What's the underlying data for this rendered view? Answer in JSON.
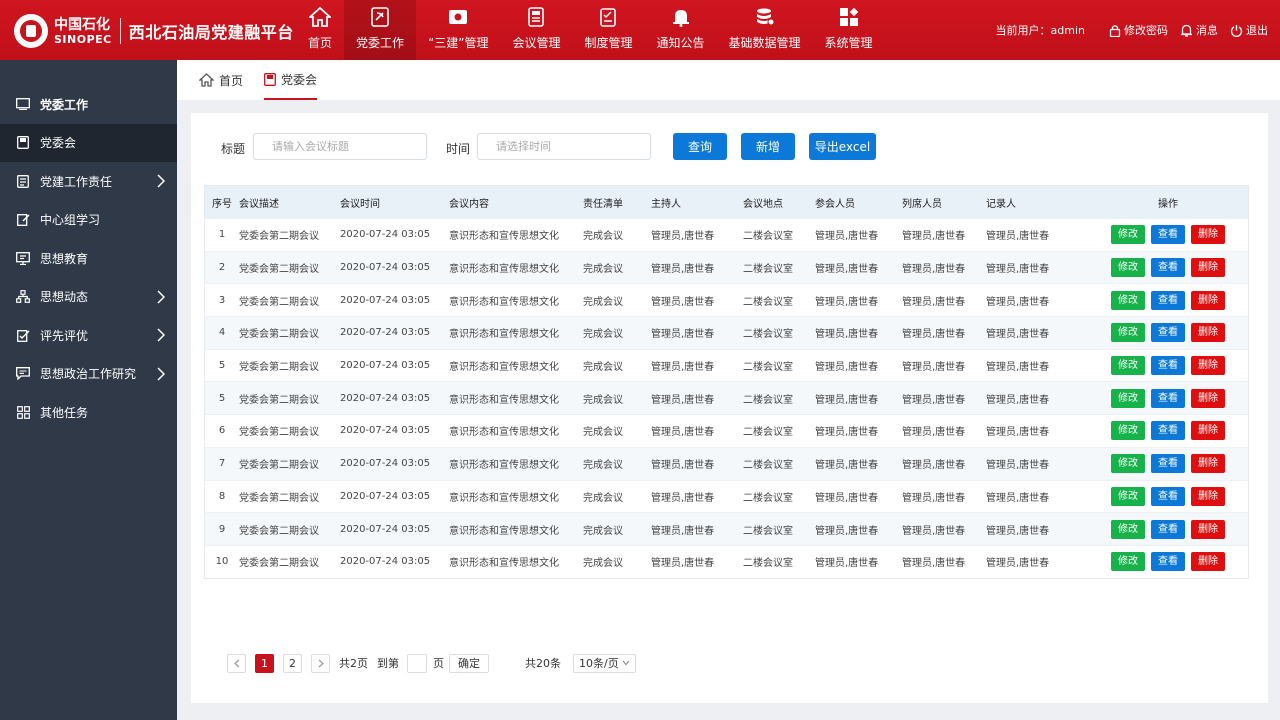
{
  "header": {
    "logo_cn": "中国石化",
    "logo_en": "SINOPEC",
    "title": "西北石油局党建融平台",
    "nav": [
      {
        "label": "首页",
        "icon": "home-icon"
      },
      {
        "label": "党委工作",
        "icon": "party-emblem-icon"
      },
      {
        "label": "“三建”管理",
        "icon": "building-icon"
      },
      {
        "label": "会议管理",
        "icon": "document-icon"
      },
      {
        "label": "制度管理",
        "icon": "checklist-icon"
      },
      {
        "label": "通知公告",
        "icon": "bell-icon"
      },
      {
        "label": "基础数据管理",
        "icon": "database-icon"
      },
      {
        "label": "系统管理",
        "icon": "grid-icon"
      }
    ],
    "current_user": "当前用户：admin",
    "change_password": "修改密码",
    "messages": "消息",
    "logout": "退出"
  },
  "sidebar": {
    "title": "党委工作",
    "items": [
      {
        "label": "党委会",
        "icon": "save-icon"
      },
      {
        "label": "党建工作责任",
        "icon": "document-icon"
      },
      {
        "label": "中心组学习",
        "icon": "edit-icon"
      },
      {
        "label": "思想教育",
        "icon": "screen-icon"
      },
      {
        "label": "思想动态",
        "icon": "org-chart-icon"
      },
      {
        "label": "评先评优",
        "icon": "edit-check-icon"
      },
      {
        "label": "思想政治工作研究",
        "icon": "chat-icon"
      },
      {
        "label": "其他任务",
        "icon": "grid-icon"
      }
    ]
  },
  "tabs": {
    "home": "首页",
    "current": "党委会"
  },
  "filters": {
    "title_label": "标题",
    "title_placeholder": "请输入会议标题",
    "time_label": "时间",
    "time_placeholder": "请选择时间",
    "search_btn": "查询",
    "add_btn": "新增",
    "export_btn": "导出excel"
  },
  "table": {
    "headers": [
      "序号",
      "会议描述",
      "会议时间",
      "会议内容",
      "责任清单",
      "主持人",
      "会议地点",
      "参会人员",
      "列席人员",
      "记录人",
      "操作"
    ],
    "rows": [
      [
        "1",
        "党委会第二期会议",
        "2020-07-24 03:05",
        "意识形态和宣传思想文化",
        "完成会议",
        "管理员,唐世春",
        "二楼会议室",
        "管理员,唐世春",
        "管理员,唐世春",
        "管理员,唐世春"
      ],
      [
        "2",
        "党委会第二期会议",
        "2020-07-24 03:05",
        "意识形态和宣传思想文化",
        "完成会议",
        "管理员,唐世春",
        "二楼会议室",
        "管理员,唐世春",
        "管理员,唐世春",
        "管理员,唐世春"
      ],
      [
        "3",
        "党委会第二期会议",
        "2020-07-24 03:05",
        "意识形态和宣传思想文化",
        "完成会议",
        "管理员,唐世春",
        "二楼会议室",
        "管理员,唐世春",
        "管理员,唐世春",
        "管理员,唐世春"
      ],
      [
        "4",
        "党委会第二期会议",
        "2020-07-24 03:05",
        "意识形态和宣传思想文化",
        "完成会议",
        "管理员,唐世春",
        "二楼会议室",
        "管理员,唐世春",
        "管理员,唐世春",
        "管理员,唐世春"
      ],
      [
        "5",
        "党委会第二期会议",
        "2020-07-24 03:05",
        "意识形态和宣传思想文化",
        "完成会议",
        "管理员,唐世春",
        "二楼会议室",
        "管理员,唐世春",
        "管理员,唐世春",
        "管理员,唐世春"
      ],
      [
        "5",
        "党委会第二期会议",
        "2020-07-24 03:05",
        "意识形态和宣传思想文化",
        "完成会议",
        "管理员,唐世春",
        "二楼会议室",
        "管理员,唐世春",
        "管理员,唐世春",
        "管理员,唐世春"
      ],
      [
        "6",
        "党委会第二期会议",
        "2020-07-24 03:05",
        "意识形态和宣传思想文化",
        "完成会议",
        "管理员,唐世春",
        "二楼会议室",
        "管理员,唐世春",
        "管理员,唐世春",
        "管理员,唐世春"
      ],
      [
        "7",
        "党委会第二期会议",
        "2020-07-24 03:05",
        "意识形态和宣传思想文化",
        "完成会议",
        "管理员,唐世春",
        "二楼会议室",
        "管理员,唐世春",
        "管理员,唐世春",
        "管理员,唐世春"
      ],
      [
        "8",
        "党委会第二期会议",
        "2020-07-24 03:05",
        "意识形态和宣传思想文化",
        "完成会议",
        "管理员,唐世春",
        "二楼会议室",
        "管理员,唐世春",
        "管理员,唐世春",
        "管理员,唐世春"
      ],
      [
        "9",
        "党委会第二期会议",
        "2020-07-24 03:05",
        "意识形态和宣传思想文化",
        "完成会议",
        "管理员,唐世春",
        "二楼会议室",
        "管理员,唐世春",
        "管理员,唐世春",
        "管理员,唐世春"
      ],
      [
        "10",
        "党委会第二期会议",
        "2020-07-24 03:05",
        "意识形态和宣传思想文化",
        "完成会议",
        "管理员,唐世春",
        "二楼会议室",
        "管理员,唐世春",
        "管理员,唐世春",
        "管理员,唐世春"
      ]
    ],
    "actions": {
      "edit": "修改",
      "view": "查看",
      "delete": "删除"
    }
  },
  "pagination": {
    "pages": [
      "1",
      "2"
    ],
    "current_page": "1",
    "total_pages": "共2页",
    "goto_label": "到第",
    "page_unit": "页",
    "confirm": "确定",
    "total_items": "共20条",
    "page_size": "10条/页"
  },
  "colors": {
    "brand_red": "#c8121c",
    "sidebar_bg": "#2f3947",
    "primary_blue": "#0c79d8",
    "success_green": "#18b24b",
    "danger_red": "#e00f0f"
  }
}
